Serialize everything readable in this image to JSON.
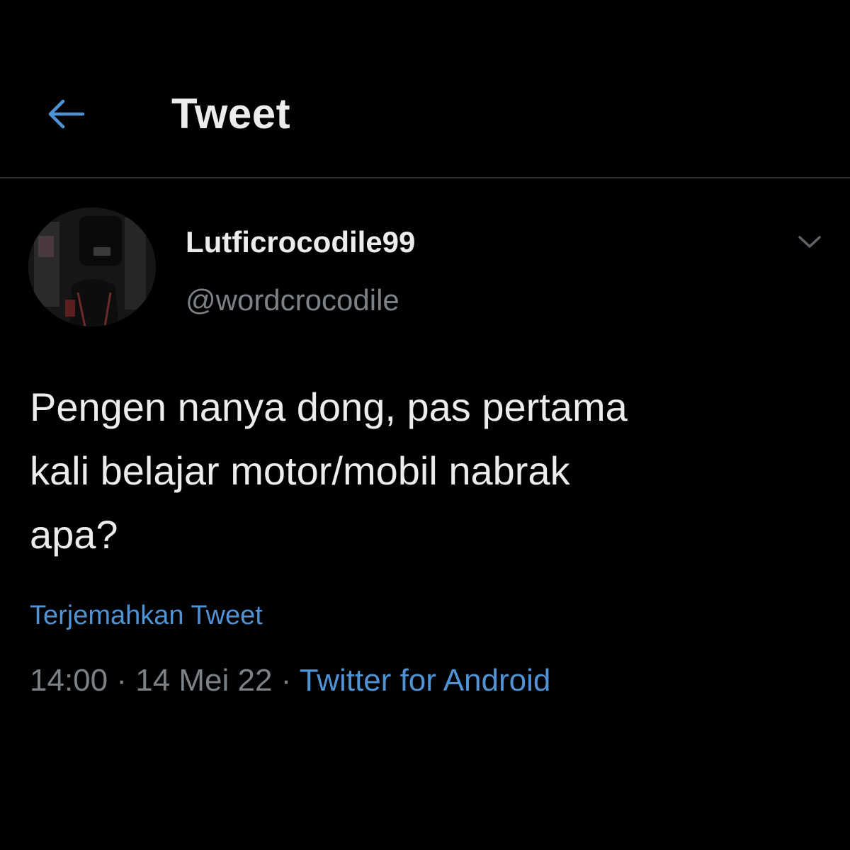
{
  "header": {
    "back_icon": "arrow-left-icon",
    "title": "Tweet"
  },
  "author": {
    "display_name": "Lutficrocodile99",
    "handle": "@wordcrocodile"
  },
  "tweet": {
    "text": "Pengen nanya dong, pas pertama\nkali belajar motor/mobil nabrak\napa?",
    "translate_label": "Terjemahkan Tweet",
    "time": "14:00",
    "date": "14 Mei 22",
    "separator": " · ",
    "source": "Twitter for Android"
  },
  "colors": {
    "background": "#000000",
    "accent": "#4f93d4",
    "muted": "#7c8186",
    "text": "#ececec"
  }
}
